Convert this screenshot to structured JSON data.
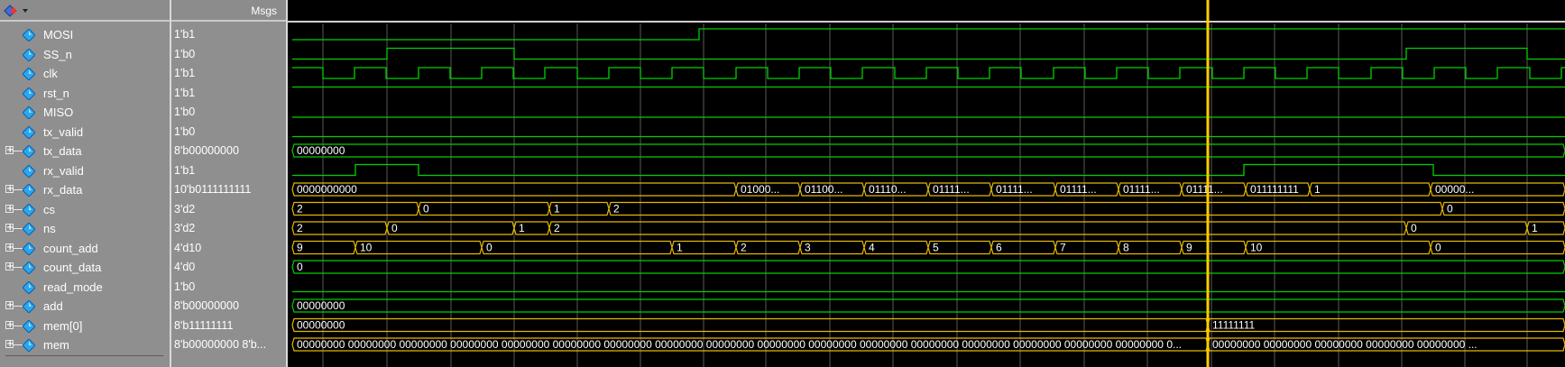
{
  "header": {
    "values_title": "Msgs"
  },
  "colors": {
    "green": "#00d000",
    "yellow": "#e6b800",
    "cursor": "#ffcc00",
    "grid": "#5a5a5a",
    "text": "#ffffff"
  },
  "signals": [
    {
      "name": "MOSI",
      "value": "1'b1",
      "expandable": false
    },
    {
      "name": "SS_n",
      "value": "1'b0",
      "expandable": false
    },
    {
      "name": "clk",
      "value": "1'b1",
      "expandable": false
    },
    {
      "name": "rst_n",
      "value": "1'b1",
      "expandable": false
    },
    {
      "name": "MISO",
      "value": "1'b0",
      "expandable": false
    },
    {
      "name": "tx_valid",
      "value": "1'b0",
      "expandable": false
    },
    {
      "name": "tx_data",
      "value": "8'b00000000",
      "expandable": true
    },
    {
      "name": "rx_valid",
      "value": "1'b1",
      "expandable": false
    },
    {
      "name": "rx_data",
      "value": "10'b0111111111",
      "expandable": true
    },
    {
      "name": "cs",
      "value": "3'd2",
      "expandable": true
    },
    {
      "name": "ns",
      "value": "3'd2",
      "expandable": true
    },
    {
      "name": "count_add",
      "value": "4'd10",
      "expandable": true
    },
    {
      "name": "count_data",
      "value": "4'd0",
      "expandable": true
    },
    {
      "name": "read_mode",
      "value": "1'b0",
      "expandable": false
    },
    {
      "name": "add",
      "value": "8'b00000000",
      "expandable": true
    },
    {
      "name": "mem[0]",
      "value": "8'b11111111",
      "expandable": true
    },
    {
      "name": "mem",
      "value": "8'b00000000 8'b...",
      "expandable": true
    }
  ],
  "bus_labels": {
    "tx_data": [
      "00000000"
    ],
    "rx_data": [
      "0000000000",
      "01000...",
      "01100...",
      "01110...",
      "01111...",
      "01111...",
      "01111...",
      "01111...",
      "01111...",
      "011111111",
      "1",
      "00000..."
    ],
    "cs": [
      "2",
      "0",
      "1",
      "2",
      "0"
    ],
    "ns": [
      "2",
      "0",
      "1",
      "2",
      "0",
      "1"
    ],
    "count_add": [
      "9",
      "10",
      "0",
      "1",
      "2",
      "3",
      "4",
      "5",
      "6",
      "7",
      "8",
      "9",
      "10",
      "0"
    ],
    "count_data": [
      "0"
    ],
    "add": [
      "00000000"
    ],
    "mem0": [
      "00000000",
      "11111111"
    ],
    "mem": [
      "00000000 00000000 00000000 00000000 00000000 00000000 00000000 00000000 00000000 00000000 00000000 00000000 00000000 00000000 00000000 00000000 00000000 0...",
      "00000000 00000000 00000000 00000000 00000000 ..."
    ]
  }
}
